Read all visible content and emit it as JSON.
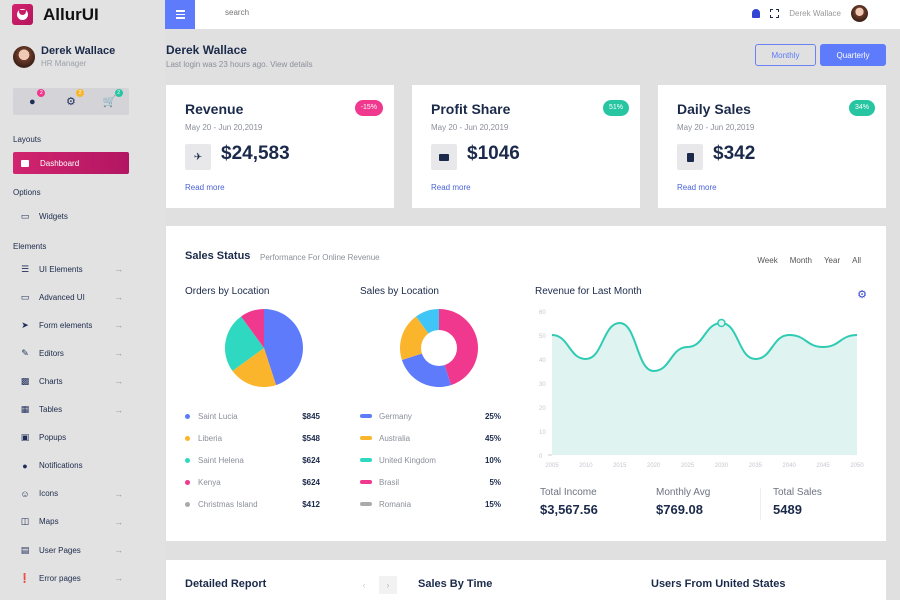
{
  "app": {
    "name": "AllurUI"
  },
  "sidebar": {
    "user": {
      "name": "Derek Wallace",
      "role": "HR Manager"
    },
    "quick_actions": [
      {
        "icon": "chat-icon",
        "badge": "2",
        "badge_color": "#f0388e"
      },
      {
        "icon": "gear-icon",
        "badge": "2",
        "badge_color": "#fbb52c"
      },
      {
        "icon": "cart-icon",
        "badge": "2",
        "badge_color": "#27c5a2"
      }
    ],
    "sections": {
      "layouts": "Layouts",
      "options": "Options",
      "elements": "Elements"
    },
    "dashboard": "Dashboard",
    "widgets": "Widgets",
    "items": [
      {
        "label": "UI Elements",
        "icon": "layers-icon",
        "arrow": true
      },
      {
        "label": "Advanced UI",
        "icon": "monitor-icon",
        "arrow": true
      },
      {
        "label": "Form elements",
        "icon": "rocket-icon",
        "arrow": true
      },
      {
        "label": "Editors",
        "icon": "pencil-icon",
        "arrow": true
      },
      {
        "label": "Charts",
        "icon": "bar-chart-icon",
        "arrow": true
      },
      {
        "label": "Tables",
        "icon": "table-icon",
        "arrow": true
      },
      {
        "label": "Popups",
        "icon": "briefcase-icon",
        "arrow": false
      },
      {
        "label": "Notifications",
        "icon": "bell-icon",
        "arrow": false
      },
      {
        "label": "Icons",
        "icon": "smile-icon",
        "arrow": true
      },
      {
        "label": "Maps",
        "icon": "map-icon",
        "arrow": true
      },
      {
        "label": "User Pages",
        "icon": "id-card-icon",
        "arrow": true
      },
      {
        "label": "Error pages",
        "icon": "alert-icon",
        "arrow": true
      }
    ]
  },
  "topbar": {
    "search_placeholder": "search",
    "user_name": "Derek Wallace"
  },
  "header": {
    "name": "Derek Wallace",
    "subtitle": "Last login was 23 hours ago. View details",
    "monthly": "Monthly",
    "quarterly": "Quarterly"
  },
  "kpis": [
    {
      "title": "Revenue",
      "date": "May 20 - Jun 20,2019",
      "value": "$24,583",
      "badge": "-15%",
      "badge_color": "#f0388e",
      "icon": "plane-icon",
      "link": "Read more"
    },
    {
      "title": "Profit Share",
      "date": "May 20 - Jun 20,2019",
      "value": "$1046",
      "badge": "51%",
      "badge_color": "#27c5a2",
      "icon": "briefcase-icon",
      "link": "Read more"
    },
    {
      "title": "Daily Sales",
      "date": "May 20 - Jun 20,2019",
      "value": "$342",
      "badge": "34%",
      "badge_color": "#27c5a2",
      "icon": "file-icon",
      "link": "Read more"
    }
  ],
  "sales_status": {
    "title": "Sales Status",
    "subtitle": "Performance For Online Revenue",
    "ranges": [
      "Week",
      "Month",
      "Year",
      "All"
    ],
    "orders_title": "Orders by Location",
    "sales_title": "Sales by Location",
    "revenue_title": "Revenue for Last Month",
    "orders": [
      {
        "name": "Saint Lucia",
        "value": "$845",
        "color": "#5d7bfa"
      },
      {
        "name": "Liberia",
        "value": "$548",
        "color": "#fbb52c"
      },
      {
        "name": "Saint Helena",
        "value": "$624",
        "color": "#2fd8c0"
      },
      {
        "name": "Kenya",
        "value": "$624",
        "color": "#f0388e"
      },
      {
        "name": "Christmas Island",
        "value": "$412",
        "color": "#aaaaaa"
      }
    ],
    "sales": [
      {
        "name": "Germany",
        "value": "25%",
        "color": "#5d7bfa"
      },
      {
        "name": "Australia",
        "value": "45%",
        "color": "#fbb52c"
      },
      {
        "name": "United Kingdom",
        "value": "10%",
        "color": "#2fd8c0"
      },
      {
        "name": "Brasil",
        "value": "5%",
        "color": "#f0388e"
      },
      {
        "name": "Romania",
        "value": "15%",
        "color": "#aaaaaa"
      }
    ],
    "stats": [
      {
        "label": "Total Income",
        "value": "$3,567.56"
      },
      {
        "label": "Monthly Avg",
        "value": "$769.08"
      },
      {
        "label": "Total Sales",
        "value": "5489"
      }
    ]
  },
  "chart_data": [
    {
      "type": "pie",
      "title": "Orders by Location",
      "slices": [
        {
          "label": "blue",
          "value": 45,
          "color": "#5d7bfa"
        },
        {
          "label": "yellow",
          "value": 20,
          "color": "#fbb52c"
        },
        {
          "label": "teal",
          "value": 25,
          "color": "#2fd8c0"
        },
        {
          "label": "pink",
          "value": 10,
          "color": "#f0388e"
        }
      ]
    },
    {
      "type": "pie",
      "title": "Sales by Location",
      "donut": true,
      "slices": [
        {
          "label": "pink",
          "value": 45,
          "color": "#f0388e"
        },
        {
          "label": "blue",
          "value": 25,
          "color": "#5d7bfa"
        },
        {
          "label": "yellow",
          "value": 20,
          "color": "#fbb52c"
        },
        {
          "label": "light-blue",
          "value": 10,
          "color": "#3fc6f7"
        }
      ]
    },
    {
      "type": "area",
      "title": "Revenue for Last Month",
      "x": [
        2005,
        2010,
        2015,
        2020,
        2025,
        2030,
        2035,
        2040,
        2045,
        2050
      ],
      "values": [
        50,
        40,
        55,
        35,
        45,
        55,
        40,
        50,
        45,
        50
      ],
      "highlight_index": 5,
      "ylim": [
        0,
        60
      ],
      "yticks": [
        0,
        10,
        20,
        30,
        40,
        50,
        60
      ],
      "color": "#2fcbb3",
      "fill": "#dff4f1"
    }
  ],
  "bottom": {
    "detailed_report": "Detailed Report",
    "sales_by_time": "Sales By Time",
    "users_us": "Users From United States",
    "prev": "‹",
    "next": "›"
  }
}
